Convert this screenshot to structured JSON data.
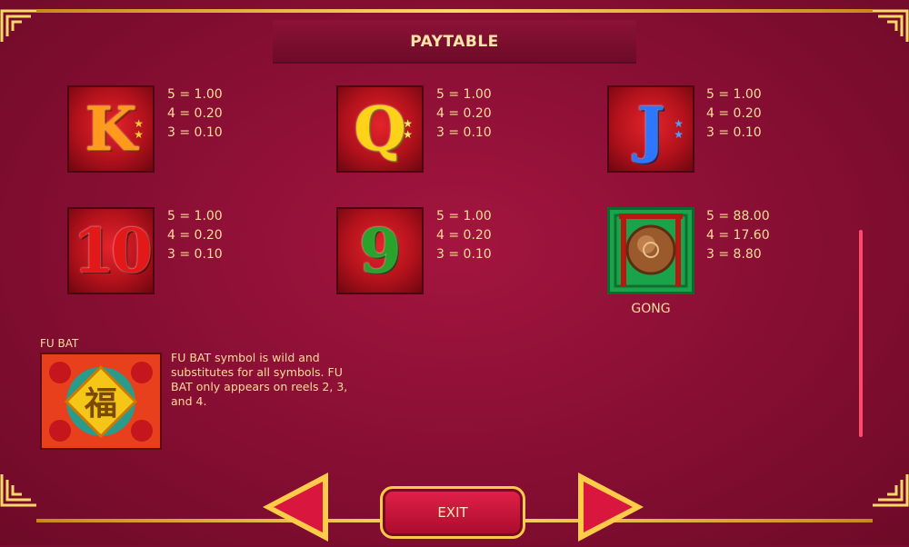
{
  "title": "PAYTABLE",
  "symbols": [
    {
      "name": "K",
      "pays": [
        "5 = 1.00",
        "4 = 0.20",
        "3 = 0.10"
      ]
    },
    {
      "name": "Q",
      "pays": [
        "5 = 1.00",
        "4 = 0.20",
        "3 = 0.10"
      ]
    },
    {
      "name": "J",
      "pays": [
        "5 = 1.00",
        "4 = 0.20",
        "3 = 0.10"
      ]
    },
    {
      "name": "10",
      "pays": [
        "5 = 1.00",
        "4 = 0.20",
        "3 = 0.10"
      ]
    },
    {
      "name": "9",
      "pays": [
        "5 = 1.00",
        "4 = 0.20",
        "3 = 0.10"
      ]
    },
    {
      "name": "GONG",
      "label": "GONG",
      "pays": [
        "5 = 88.00",
        "4 = 17.60",
        "3 = 8.80"
      ]
    }
  ],
  "fubat": {
    "title": "FU BAT",
    "glyph": "福",
    "description": "FU BAT symbol is wild and substitutes for all symbols. FU BAT only appears on reels 2, 3, and 4."
  },
  "buttons": {
    "exit": "EXIT",
    "prev_icon": "left-arrow-icon",
    "next_icon": "right-arrow-icon"
  },
  "colors": {
    "background": "#8b0f35",
    "gold": "#ffd86a",
    "text": "#ffdd9a",
    "exit": "#e4214a"
  }
}
